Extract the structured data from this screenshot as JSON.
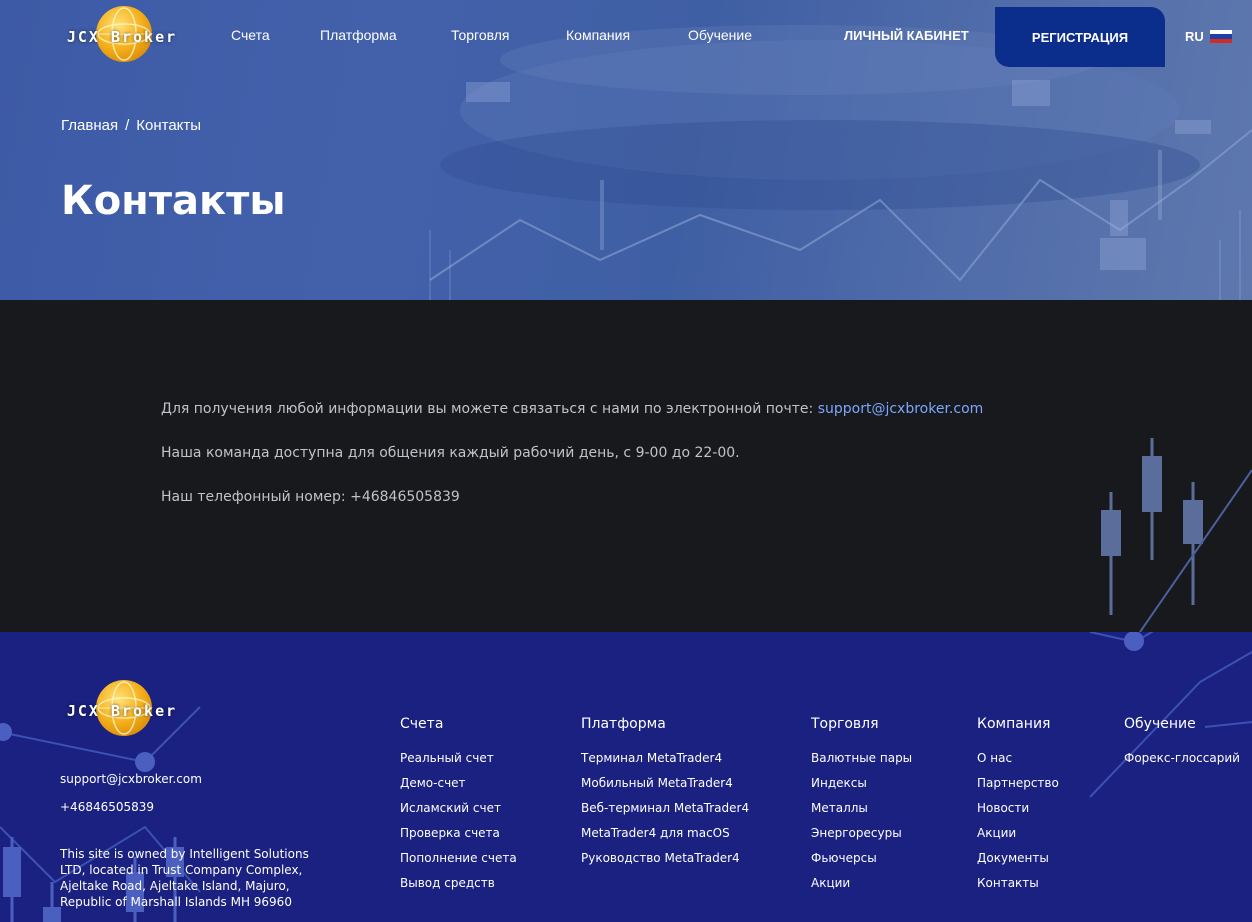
{
  "brand": {
    "name": "JCX Broker",
    "logo_colors": [
      "#ffe27a",
      "#f6b21e",
      "#d98a06"
    ]
  },
  "nav": {
    "items": [
      {
        "label": "Счета"
      },
      {
        "label": "Платформа"
      },
      {
        "label": "Торговля"
      },
      {
        "label": "Компания"
      },
      {
        "label": "Обучение"
      }
    ],
    "cabinet_label": "ЛИЧНЫЙ КАБИНЕТ",
    "register_label": "РЕГИСТРАЦИЯ",
    "lang_label": "RU",
    "lang_flag": "russia-flag-icon"
  },
  "breadcrumb": {
    "home": "Главная",
    "separator": "/",
    "current": "Контакты"
  },
  "page_title": "Контакты",
  "content": {
    "email_text": "Для получения любой информации вы можете связаться с нами по электронной почте: ",
    "email": "support@jcxbroker.com",
    "hours_text": "Наша команда доступна для общения каждый рабочий день, с 9-00 до 22-00.",
    "phone_text": "Наш телефонный номер: +46846505839"
  },
  "footer": {
    "email": "support@jcxbroker.com",
    "phone": "+46846505839",
    "legal": "This site is owned by Intelligent Solutions LTD, located in Trust Company Complex, Ajeltake Road, Ajeltake Island, Majuro, Republic of Marshall Islands MH 96960",
    "columns": [
      {
        "title": "Счета",
        "links": [
          "Реальный счет",
          "Демо-счет",
          "Исламский счет",
          "Проверка счета",
          "Пополнение счета",
          "Вывод средств"
        ]
      },
      {
        "title": "Платформа",
        "links": [
          "Терминал MetaTrader4",
          "Мобильный MetaTrader4",
          "Веб-терминал MetaTrader4",
          "MetaTrader4 для macOS",
          "Руководство MetaTrader4"
        ]
      },
      {
        "title": "Торговля",
        "links": [
          "Валютные пары",
          "Индексы",
          "Металлы",
          "Энергоресуры",
          "Фьючерсы",
          "Акции"
        ]
      },
      {
        "title": "Компания",
        "links": [
          "О нас",
          "Партнерство",
          "Новости",
          "Акции",
          "Документы",
          "Контакты"
        ]
      },
      {
        "title": "Обучение",
        "links": [
          "Форекс-глоссарий"
        ]
      }
    ]
  },
  "colors": {
    "hero_blue": "#4361ab",
    "register_bg": "#0b2d8c",
    "content_bg": "#17191c",
    "footer_bg": "#1a2180",
    "link": "#7ea6ff"
  }
}
